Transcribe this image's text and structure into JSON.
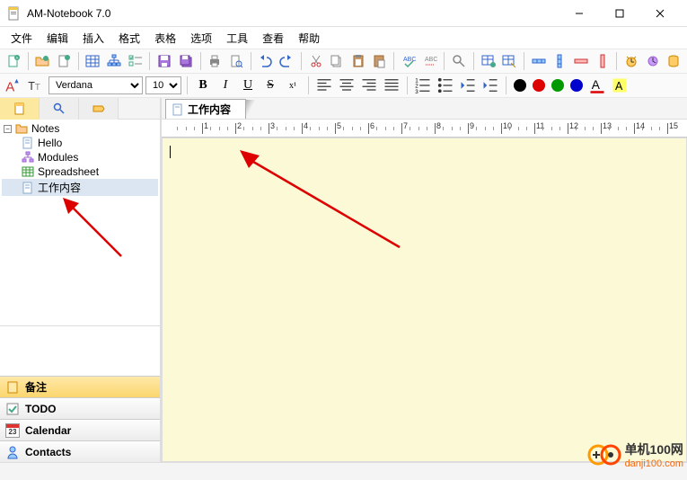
{
  "title": "AM-Notebook  7.0",
  "menu": [
    "文件",
    "编辑",
    "插入",
    "格式",
    "表格",
    "选项",
    "工具",
    "查看",
    "帮助"
  ],
  "font": {
    "name": "Verdana",
    "size": "10"
  },
  "tree": {
    "root": "Notes",
    "items": [
      {
        "label": "Hello",
        "type": "note"
      },
      {
        "label": "Modules",
        "type": "modules"
      },
      {
        "label": "Spreadsheet",
        "type": "sheet"
      },
      {
        "label": "工作内容",
        "type": "note"
      }
    ],
    "selected": 3
  },
  "panels": [
    {
      "label": "备注",
      "active": true
    },
    {
      "label": "TODO",
      "active": false
    },
    {
      "label": "Calendar",
      "active": false
    },
    {
      "label": "Contacts",
      "active": false
    }
  ],
  "docTab": "工作内容",
  "calday": "23",
  "ruler": {
    "majors": [
      1,
      2,
      3,
      4,
      5,
      6,
      7,
      8,
      9,
      10,
      11,
      12,
      13,
      14,
      15
    ]
  },
  "watermark": {
    "line1": "单机100网",
    "line2": "danji100.com"
  }
}
